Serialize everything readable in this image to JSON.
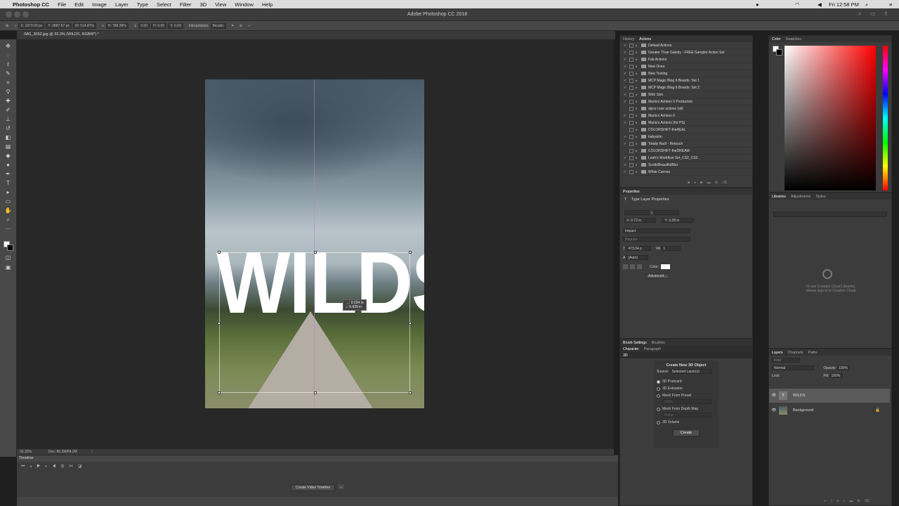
{
  "menu": {
    "app": "Photoshop CC",
    "items": [
      "File",
      "Edit",
      "Image",
      "Layer",
      "Type",
      "Select",
      "Filter",
      "3D",
      "View",
      "Window",
      "Help"
    ],
    "clock": "Fri 12:58 PM"
  },
  "window": {
    "title": "Adobe Photoshop CC 2018"
  },
  "options": {
    "x": "X: 1873.00 px",
    "y": "Y: 3887.67 px",
    "w": "W: 514.87%",
    "h": "H: 788.39%",
    "angle": "0.00",
    "hskew": "H: 0.00",
    "vskew": "V: 0.00",
    "interp_label": "Interpolation:",
    "interp_value": "Bicubic"
  },
  "doc": {
    "tab": "IMG_3052.jpg @ 33.3% (WILDS, RGB/8*) *",
    "text": "WILDS",
    "tooltip_line1": "→: 0.034 in",
    "tooltip_line2": "↓: 5.639 in",
    "zoom": "33.33%",
    "docsize": "Doc: 80.2M/84.2M"
  },
  "timeline": {
    "title": "Timeline",
    "create_btn": "Create Video Timeline"
  },
  "history_panel": {
    "tabs": [
      "History",
      "Actions"
    ],
    "actions": [
      {
        "checked": true,
        "name": "Default Actions"
      },
      {
        "checked": true,
        "name": "Greater Than Gatsby - FREE Sampler Action Set"
      },
      {
        "checked": true,
        "name": "Fab Actions"
      },
      {
        "checked": true,
        "name": "New Ones"
      },
      {
        "checked": true,
        "name": "New Testing"
      },
      {
        "checked": true,
        "name": "MCP Magic Blog It Boards: Set 1"
      },
      {
        "checked": true,
        "name": "MCP Magic Blog It Boards: Set 2"
      },
      {
        "checked": true,
        "name": "Web Size"
      },
      {
        "checked": true,
        "name": "Marta's Actions II Production"
      },
      {
        "checked": false,
        "name": "alyce rose actions (all)"
      },
      {
        "checked": true,
        "name": "Marta's Actions II"
      },
      {
        "checked": true,
        "name": "Marta's Actions (for PS)"
      },
      {
        "checked": false,
        "name": "COLORSHIFT-theREAL"
      },
      {
        "checked": true,
        "name": "babyskin"
      },
      {
        "checked": true,
        "name": "Totally Rad! - Retouch"
      },
      {
        "checked": false,
        "name": "COLORSHIFT-theDREAM"
      },
      {
        "checked": true,
        "name": "Leah's Workflow Set_CS2_CS3"
      },
      {
        "checked": true,
        "name": "ScottsBeautifulBlur"
      },
      {
        "checked": true,
        "name": "White Canvas"
      }
    ]
  },
  "properties": {
    "title": "Properties",
    "subtitle": "Type Layer Properties",
    "x": "X: 0.72 in",
    "y": "Y: 3.28 in",
    "font": "Impact",
    "style": "Regular",
    "size": "473.04 p",
    "tracking": "1",
    "leading": "(Auto)",
    "color_label": "Color:",
    "advanced": "Advanced..."
  },
  "char3d": {
    "tabs1": [
      "Brush Settings",
      "Brushes"
    ],
    "tabs2": [
      "Character",
      "Paragraph"
    ],
    "tab3d": "3D",
    "title": "Create New 3D Object",
    "source_label": "Source:",
    "source_value": "Selected Layer(s)",
    "options": [
      "3D Postcard",
      "3D Extrusion",
      "Mesh From Preset",
      "Mesh From Depth Map",
      "3D Volume"
    ],
    "preset": "Cone",
    "depth": "Plane",
    "create": "Create"
  },
  "color_panel": {
    "tabs": [
      "Color",
      "Swatches"
    ]
  },
  "libraries": {
    "tabs": [
      "Libraries",
      "Adjustments",
      "Styles"
    ],
    "message1": "To use Creative Cloud Libraries,",
    "message2": "please sign in to Creative Cloud"
  },
  "layers": {
    "tabs": [
      "Layers",
      "Channels",
      "Paths"
    ],
    "kind": "Kind",
    "blend": "Normal",
    "opacity_label": "Opacity:",
    "opacity": "100%",
    "lock_label": "Lock:",
    "fill_label": "Fill:",
    "fill": "100%",
    "items": [
      {
        "name": "WILDS",
        "type": "text"
      },
      {
        "name": "Background",
        "type": "image"
      }
    ]
  }
}
